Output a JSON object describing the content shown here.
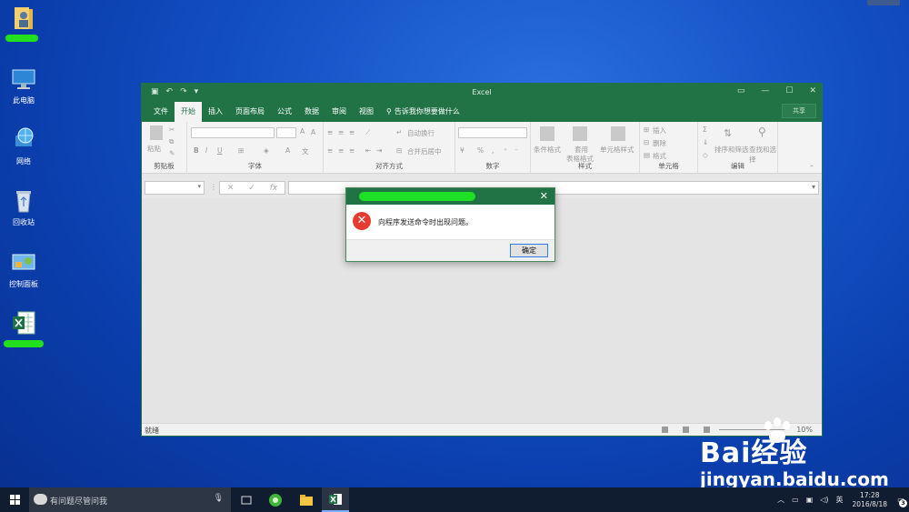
{
  "desktop": {
    "icons": [
      {
        "label": "",
        "icon": "user-folder-icon"
      },
      {
        "label": "此电脑",
        "icon": "computer-icon"
      },
      {
        "label": "网络",
        "icon": "network-globe-icon"
      },
      {
        "label": "回收站",
        "icon": "recycle-bin-icon"
      },
      {
        "label": "控制面板",
        "icon": "control-panel-icon"
      },
      {
        "label": "",
        "icon": "excel-file-icon"
      }
    ]
  },
  "excel": {
    "app_title": "Excel",
    "tabs": [
      "文件",
      "开始",
      "插入",
      "页面布局",
      "公式",
      "数据",
      "审阅",
      "视图"
    ],
    "active_tab": "开始",
    "tell_me": "告诉我你想要做什么",
    "share_label": "共享",
    "ribbon": {
      "clipboard": {
        "label": "剪贴板",
        "paste": "粘贴"
      },
      "font": {
        "label": "字体",
        "bold": "B",
        "italic": "I",
        "underline": "U"
      },
      "alignment": {
        "label": "对齐方式",
        "wrap": "自动换行",
        "merge": "合并后居中"
      },
      "number": {
        "label": "数字",
        "percent": "%"
      },
      "styles": {
        "label": "样式",
        "conditional": "条件格式",
        "table_line1": "套用",
        "table_line2": "表格格式",
        "cell_styles": "单元格样式"
      },
      "cells": {
        "label": "单元格",
        "insert": "插入",
        "delete": "删除",
        "format": "格式"
      },
      "editing": {
        "label": "编辑",
        "sort": "排序和筛选",
        "find": "查找和选择"
      }
    },
    "formula_bar": {
      "fx": "fx",
      "cancel": "✕",
      "enter": "✓"
    },
    "status": {
      "ready": "就绪",
      "zoom": "10%"
    }
  },
  "dialog": {
    "message": "向程序发送命令时出现问题。",
    "ok_label": "确定",
    "close": "✕"
  },
  "taskbar": {
    "search_placeholder": "有问题尽管问我",
    "ime": "英",
    "time": "17:28",
    "date": "2016/8/18",
    "notifications": "3"
  },
  "watermark": {
    "brand": "Bai经验",
    "url": "jingyan.baidu.com"
  },
  "colors": {
    "excel_green": "#217346",
    "error_red": "#e53c31",
    "desktop_blue": "#1553c7",
    "taskbar": "#101c2f"
  }
}
